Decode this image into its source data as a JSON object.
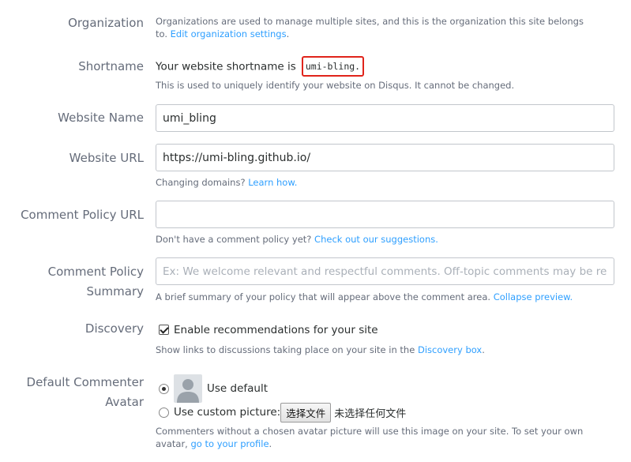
{
  "organization": {
    "label": "Organization",
    "help_text": "Organizations are used to manage multiple sites, and this is the organization this site belongs to.",
    "help_link": "Edit organization settings",
    "help_link_end": "."
  },
  "shortname": {
    "label": "Shortname",
    "prefix": "Your website shortname is",
    "value": "umi-bling.",
    "help_text": "This is used to uniquely identify your website on Disqus. It cannot be changed."
  },
  "website_name": {
    "label": "Website Name",
    "value": "umi_bling"
  },
  "website_url": {
    "label": "Website URL",
    "value": "https://umi-bling.github.io/",
    "help_text": "Changing domains?",
    "help_link": "Learn how."
  },
  "comment_policy_url": {
    "label": "Comment Policy URL",
    "value": "",
    "help_text": "Don't have a comment policy yet?",
    "help_link": "Check out our suggestions."
  },
  "comment_policy_summary": {
    "label_line1": "Comment Policy",
    "label_line2": "Summary",
    "placeholder": "Ex: We welcome relevant and respectful comments. Off-topic comments may be removed.",
    "help_text": "A brief summary of your policy that will appear above the comment area.",
    "help_link": "Collapse preview."
  },
  "discovery": {
    "label": "Discovery",
    "checkbox_label": "Enable recommendations for your site",
    "checked": true,
    "help_text": "Show links to discussions taking place on your site in the",
    "help_link": "Discovery box",
    "help_link_end": "."
  },
  "default_avatar": {
    "label_line1": "Default Commenter",
    "label_line2": "Avatar",
    "option_default": "Use default",
    "option_custom": "Use custom picture:",
    "file_button": "选择文件",
    "file_status": "未选择任何文件",
    "selected": "default",
    "help_text": "Commenters without a chosen avatar picture will use this image on your site. To set your own avatar,",
    "help_link": "go to your profile",
    "help_link_end": "."
  },
  "icons": {
    "checkbox": "check-icon",
    "avatar": "default-avatar-icon"
  }
}
